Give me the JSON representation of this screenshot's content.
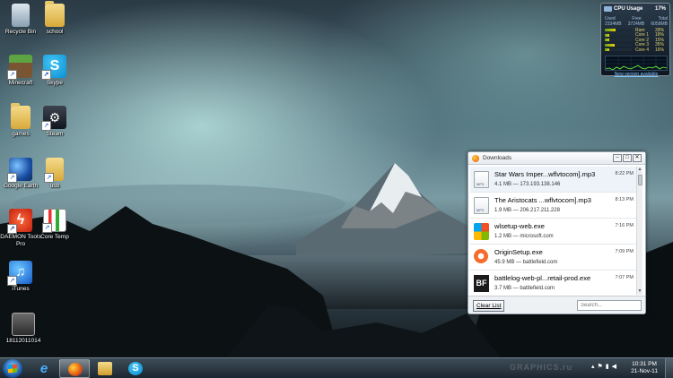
{
  "desktop_icons": [
    {
      "label": "Recycle Bin",
      "icon": "recycle-bin-icon"
    },
    {
      "label": "school",
      "icon": "folder-icon"
    },
    {
      "label": "Minecraft",
      "icon": "minecraft-icon"
    },
    {
      "label": "Skype",
      "icon": "skype-icon"
    },
    {
      "label": "games",
      "icon": "folder-icon"
    },
    {
      "label": "Steam",
      "icon": "steam-icon"
    },
    {
      "label": "Google Earth",
      "icon": "google-earth-icon"
    },
    {
      "label": "usb",
      "icon": "folder-icon"
    },
    {
      "label": "DAEMON Tools Pro",
      "icon": "daemon-tools-icon"
    },
    {
      "label": "Core Temp",
      "icon": "core-temp-icon"
    },
    {
      "label": "iTunes",
      "icon": "itunes-icon"
    },
    {
      "label": "18112011014",
      "icon": "image-file-icon"
    }
  ],
  "cpu_gadget": {
    "title": "CPU Usage",
    "percent": "17%",
    "mem_headers": [
      "Used",
      "Free",
      "Total"
    ],
    "mem_values": [
      "2334MB",
      "3724MB",
      "6058MB"
    ],
    "rows": [
      {
        "name": "Ram",
        "value": "39%",
        "fill": 0.39
      },
      {
        "name": "Core 1",
        "value": "18%",
        "fill": 0.18
      },
      {
        "name": "Core 2",
        "value": "15%",
        "fill": 0.15
      },
      {
        "name": "Core 3",
        "value": "35%",
        "fill": 0.35
      },
      {
        "name": "Core 4",
        "value": "16%",
        "fill": 0.16
      }
    ],
    "note": "New version available"
  },
  "downloads": {
    "title": "Downloads",
    "items": [
      {
        "name": "Star Wars Imper...wflvtocom].mp3",
        "meta": "4.1 MB — 173.193.138.146",
        "time": "8:22 PM",
        "icon": "mp3-file-icon"
      },
      {
        "name": "The Aristocats ...wflvtocom].mp3",
        "meta": "1.9 MB — 206.217.211.228",
        "time": "8:13 PM",
        "icon": "mp3-file-icon"
      },
      {
        "name": "wlsetup-web.exe",
        "meta": "1.2 MB — microsoft.com",
        "time": "7:16 PM",
        "icon": "windows-live-icon"
      },
      {
        "name": "OriginSetup.exe",
        "meta": "45.9 MB — battlefield.com",
        "time": "7:09 PM",
        "icon": "origin-icon"
      },
      {
        "name": "battlelog-web-pl...retail-prod.exe",
        "meta": "3.7 MB — battlefield.com",
        "time": "7:07 PM",
        "icon": "battlefield-icon"
      }
    ],
    "clear_label": "Clear List",
    "search_placeholder": "Search..."
  },
  "taskbar": {
    "pinned": [
      "internet-explorer-icon",
      "firefox-icon",
      "windows-explorer-icon",
      "skype-icon"
    ],
    "time": "10:31 PM",
    "date": "21-Nov-11",
    "watermark": "GRAPHICS.ru"
  }
}
